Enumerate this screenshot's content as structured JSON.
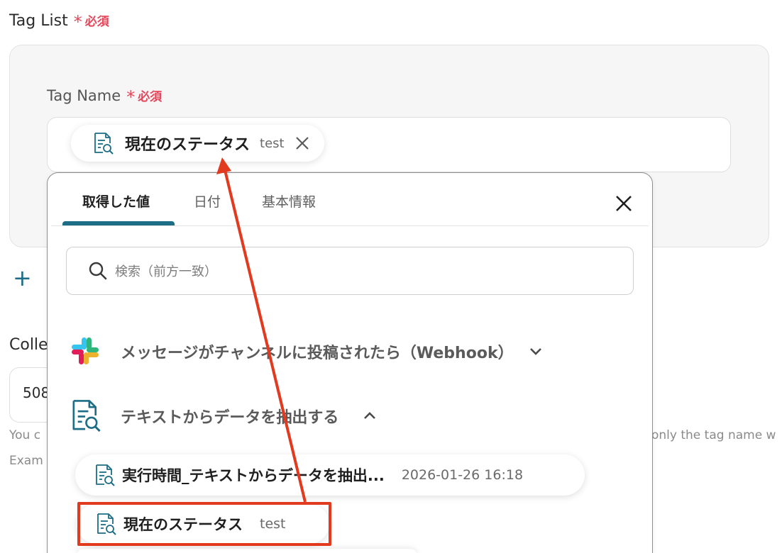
{
  "tag_list": {
    "label": "Tag List",
    "required_star": "*",
    "required_text": "必須"
  },
  "tag_name": {
    "label": "Tag Name",
    "required_star": "*",
    "required_text": "必須",
    "selected_chip": {
      "title": "現在のステータス",
      "subtitle": "test",
      "icon": "document-search-icon"
    }
  },
  "background": {
    "add_symbol": "+",
    "collection_label_fragment": "Colle",
    "collection_value_fragment": "508",
    "help_left_fragment": "You c",
    "help_right_fragment": "only the tag name w",
    "example_fragment": "Exam"
  },
  "popup": {
    "tabs": [
      {
        "label": "取得した値",
        "active": true
      },
      {
        "label": "日付",
        "active": false
      },
      {
        "label": "基本情報",
        "active": false
      }
    ],
    "search_placeholder": "検索（前方一致）",
    "sections": [
      {
        "title": "メッセージがチャンネルに投稿されたら（Webhook）",
        "icon": "slack-icon",
        "expanded": false
      },
      {
        "title": "テキストからデータを抽出する",
        "icon": "document-search-icon",
        "expanded": true
      }
    ],
    "items": [
      {
        "title": "実行時間_テキストからデータを抽出...",
        "subtitle": "2026-01-26 16:18"
      },
      {
        "title": "現在のステータス",
        "subtitle": "test"
      }
    ]
  },
  "colors": {
    "accent": "#1c6d85",
    "required": "#e5475a",
    "annotation": "#e23a1e"
  }
}
